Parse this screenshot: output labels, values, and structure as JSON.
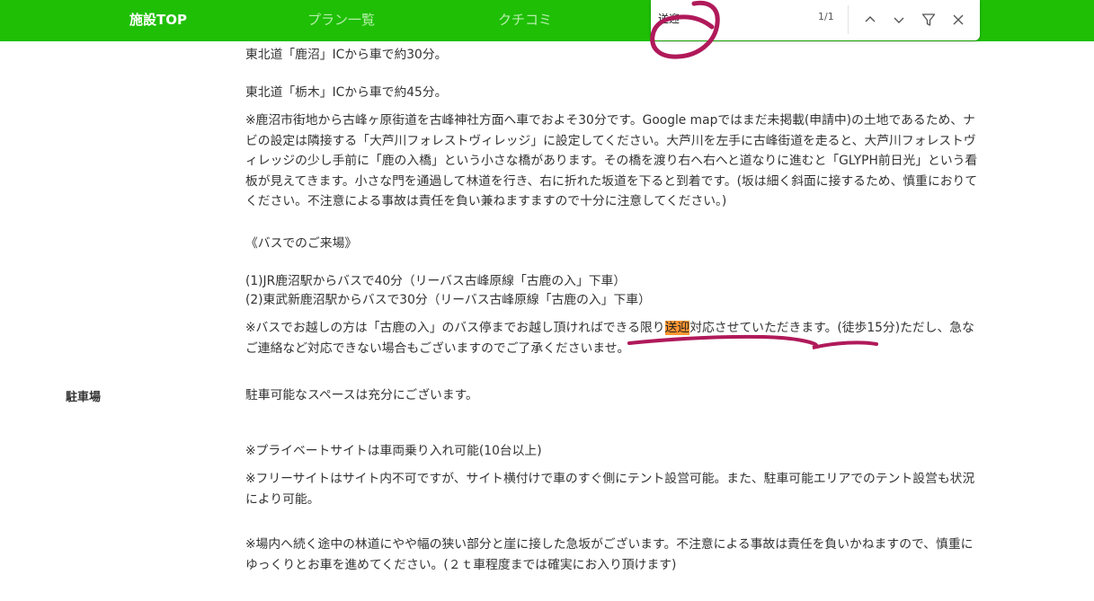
{
  "nav": {
    "items": [
      {
        "label": "施設TOP"
      },
      {
        "label": "プラン一覧"
      },
      {
        "label": "クチコミ"
      }
    ]
  },
  "find": {
    "query": "送迎",
    "count": "1/1",
    "icons": [
      "chevron-up-icon",
      "chevron-down-icon",
      "filter-icon",
      "close-icon"
    ]
  },
  "access": {
    "car1": "東北道「鹿沼」ICから車で約30分。",
    "car2": "東北道「栃木」ICから車で約45分。",
    "car_note": "※鹿沼市街地から古峰ヶ原街道を古峰神社方面へ車でおよそ30分です。Google mapではまだ未掲載(申請中)の土地であるため、ナビの設定は隣接する「大芦川フォレストヴィレッジ」に設定してください。大芦川を左手に古峰街道を走ると、大芦川フォレストヴィレッジの少し手前に「鹿の入橋」という小さな橋があります。その橋を渡り右へ右へと道なりに進むと「GLYPH前日光」という看板が見えてきます。小さな門を通過して林道を行き、右に折れた坂道を下ると到着です。(坂は細く斜面に接するため、慎重におりてください。不注意による事故は責任を負い兼ねますますので十分に注意してください。)",
    "bus_heading": "《バスでのご来場》",
    "bus1": "(1)JR鹿沼駅からバスで40分（リーバス古峰原線「古鹿の入」下車）",
    "bus2": "(2)東武新鹿沼駅からバスで30分（リーバス古峰原線「古鹿の入」下車）",
    "bus_note_before": "※バスでお越しの方は「古鹿の入」のバス停までお越し頂ければできる限り",
    "bus_note_match": "送迎",
    "bus_note_after": "対応させていただきます。(徒歩15分)ただし、急なご連絡など対応できない場合もございますのでご了承くださいませ。"
  },
  "parking": {
    "label": "駐車場",
    "p1": "駐車可能なスペースは充分にございます。",
    "p2": "※プライベートサイトは車両乗り入れ可能(10台以上)",
    "p3": "※フリーサイトはサイト内不可ですが、サイト横付けで車のすぐ側にテント設営可能。また、駐車可能エリアでのテント設営も状況により可能。",
    "p4": "※場内へ続く途中の林道にやや幅の狭い部分と崖に接した急坂がございます。不注意による事故は責任を負いかねますので、慎重にゆっくりとお車を進めてください。(２ｔ車程度までは確実にお入り頂けます)"
  },
  "colors": {
    "nav_bg": "#1fbf06",
    "highlight": "#ff9632",
    "annotation": "#b0195a"
  }
}
